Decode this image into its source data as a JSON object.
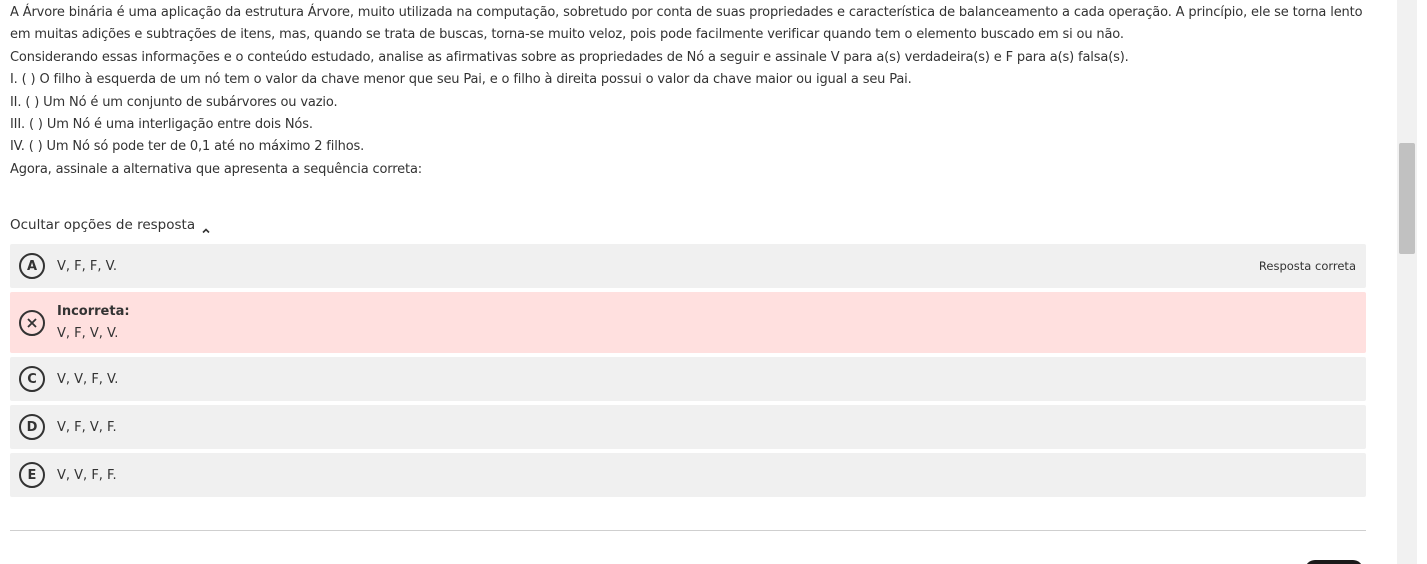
{
  "question": {
    "paragraphs": [
      "A Árvore binária é uma aplicação da estrutura Árvore, muito utilizada na computação, sobretudo por conta de suas propriedades e característica de balanceamento a cada operação. A princípio, ele se torna lento em muitas adições e subtrações de itens, mas, quando se trata de buscas, torna-se muito veloz, pois pode facilmente verificar quando tem o elemento buscado em si ou não.",
      "Considerando essas informações e o conteúdo estudado, analise as afirmativas sobre as propriedades de Nó a seguir e assinale V para a(s) verdadeira(s) e F para a(s) falsa(s).",
      "I. ( ) O filho à esquerda de um nó tem o valor da chave menor que seu Pai, e o filho à direita possui o valor da chave maior ou igual a seu Pai.",
      "II. ( ) Um Nó é um conjunto de subárvores ou vazio.",
      "III. ( ) Um Nó é uma interligação entre dois Nós.",
      "IV. ( ) Um Nó só pode ter de 0,1 até no máximo 2 filhos.",
      "Agora, assinale a alternativa que apresenta a sequência correta:"
    ]
  },
  "toggle": {
    "label": "Ocultar opções de resposta",
    "icon": "chevron-up-icon"
  },
  "options": [
    {
      "letter": "A",
      "text": "V, F, F, V.",
      "right_label": "Resposta correta"
    },
    {
      "status": "Incorreta:",
      "text": "V, F, V, V.",
      "icon": "close-circle-icon"
    },
    {
      "letter": "C",
      "text": "V, V, F, V."
    },
    {
      "letter": "D",
      "text": "V, F, V, F."
    },
    {
      "letter": "E",
      "text": "V, V, F, F."
    }
  ],
  "colors": {
    "option_bg": "#f0f0f0",
    "incorrect_bg": "#ffe0df",
    "text": "#333333"
  }
}
